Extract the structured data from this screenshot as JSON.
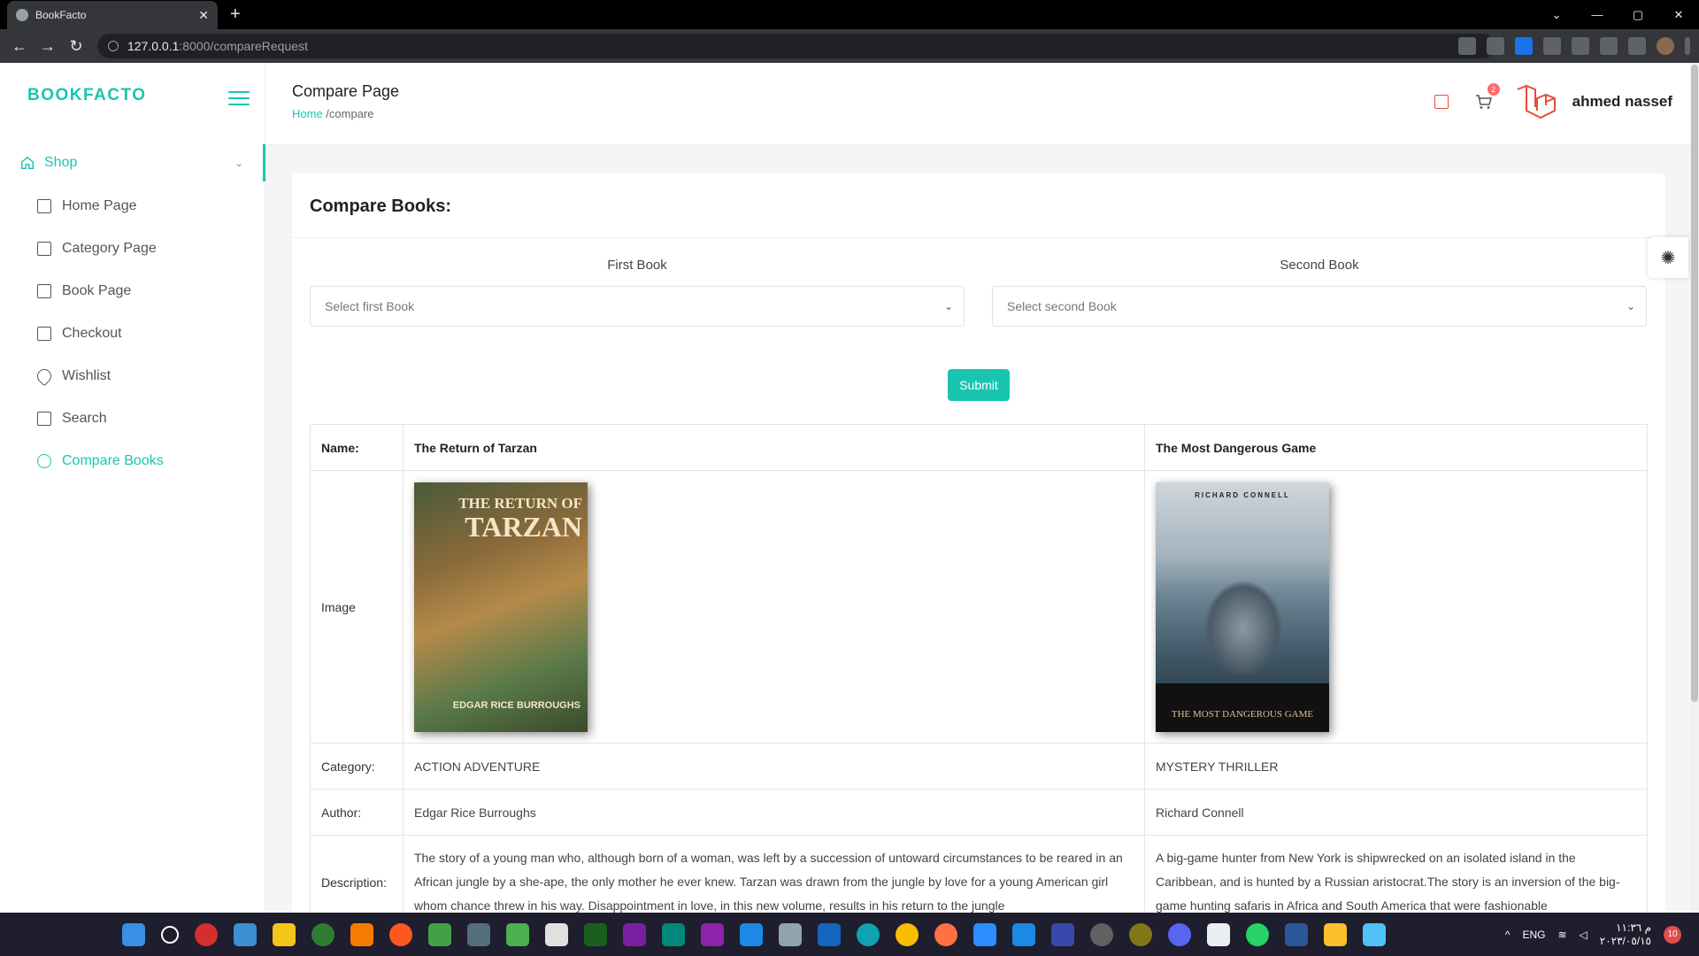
{
  "browser": {
    "tab_title": "BookFacto",
    "tab_close": "✕",
    "new_tab": "+",
    "url_host": "127.0.0.1",
    "url_rest": ":8000/compareRequest",
    "back": "←",
    "forward": "→",
    "reload": "↻",
    "win_min": "—",
    "win_max": "▢",
    "win_close": "✕",
    "tab_menu": "⌄"
  },
  "sidebar": {
    "brand": "BOOKFACTO",
    "shop_label": "Shop",
    "items": [
      {
        "label": "Home Page",
        "icon": "home-icon"
      },
      {
        "label": "Category Page",
        "icon": "grid-icon"
      },
      {
        "label": "Book Page",
        "icon": "book-icon"
      },
      {
        "label": "Checkout",
        "icon": "copy-icon"
      },
      {
        "label": "Wishlist",
        "icon": "heart-icon"
      },
      {
        "label": "Search",
        "icon": "file-search-icon"
      },
      {
        "label": "Compare Books",
        "icon": "compare-icon",
        "active": true
      }
    ]
  },
  "header": {
    "title": "Compare Page",
    "breadcrumb_home": "Home",
    "breadcrumb_current": " /compare",
    "cart_count": "2",
    "user_name": "ahmed nassef"
  },
  "compare": {
    "heading": "Compare Books:",
    "first_label": "First Book",
    "second_label": "Second Book",
    "first_placeholder": "Select first Book",
    "second_placeholder": "Select second Book",
    "submit_label": "Submit"
  },
  "table": {
    "name_label": "Name:",
    "image_label": "Image",
    "category_label": "Category:",
    "author_label": "Author:",
    "description_label": "Description:",
    "book1": {
      "name": "The Return of Tarzan",
      "category": "ACTION ADVENTURE",
      "author": "Edgar Rice Burroughs",
      "description": "The story of a young man who, although born of a woman, was left by a succession of untoward circumstances to be reared in an African jungle by a she-ape, the only mother he ever knew. Tarzan was drawn from the jungle by love for a young American girl whom chance threw in his way. Disappointment in love, in this new volume, results in his return to the jungle",
      "cover_line1": "THE RETURN OF",
      "cover_line2": "TARZAN",
      "cover_author": "EDGAR RICE BURROUGHS"
    },
    "book2": {
      "name": "The Most Dangerous Game",
      "category": "MYSTERY THRILLER",
      "author": "Richard Connell",
      "description": "A big-game hunter from New York is shipwrecked on an isolated island in the Caribbean, and is hunted by a Russian aristocrat.The story is an inversion of the big-game hunting safaris in Africa and South America that were fashionable",
      "cover_author": "RICHARD CONNELL",
      "cover_title": "THE MOST DANGEROUS GAME"
    }
  },
  "taskbar": {
    "lang": "ENG",
    "time": "م ١١:٣٦",
    "date": "٢٠٢٣/٠٥/١٥",
    "notifications": "10"
  },
  "colors": {
    "accent": "#19c5b0",
    "danger": "#e74c3c"
  }
}
